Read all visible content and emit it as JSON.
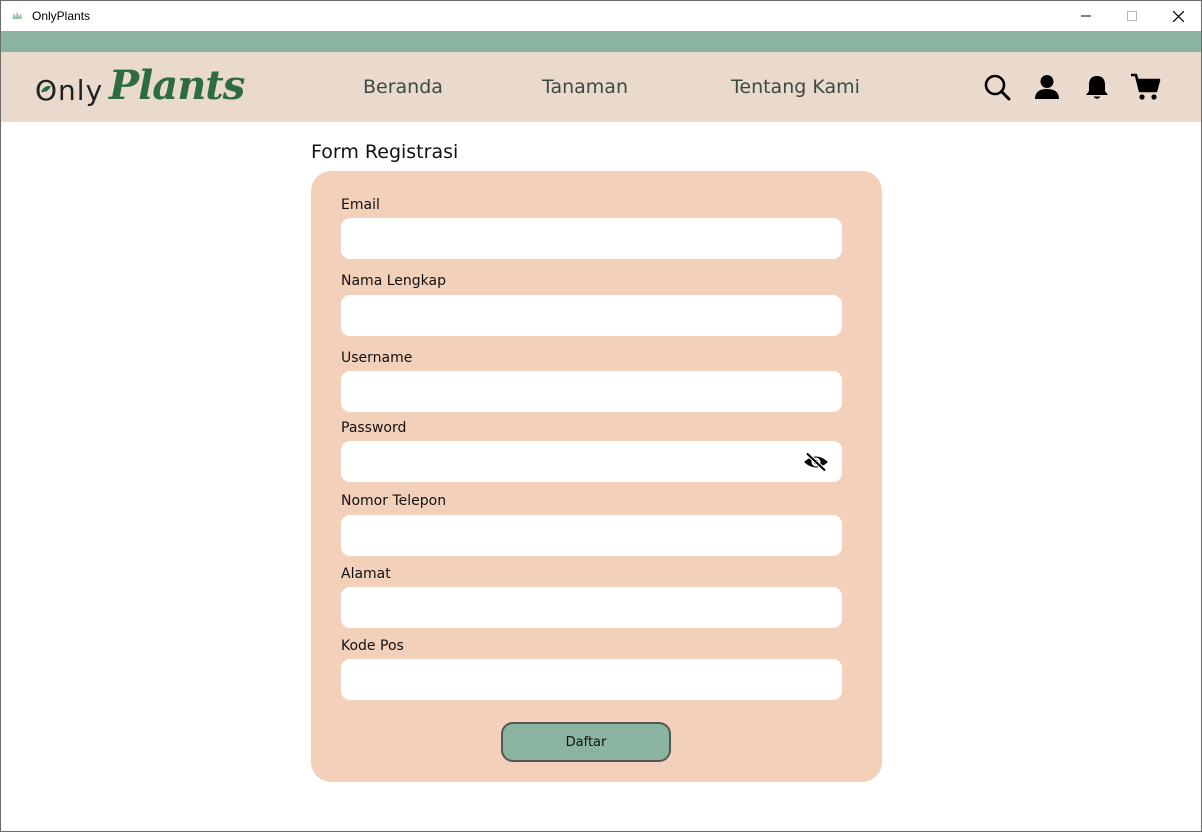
{
  "window": {
    "title": "OnlyPlants",
    "controls": [
      "minimize-icon",
      "maximize-icon",
      "close-icon"
    ]
  },
  "logo": {
    "part1": "Only",
    "part2": "Plants"
  },
  "nav": {
    "links": [
      "Beranda",
      "Tanaman",
      "Tentang Kami"
    ],
    "icons": [
      "search-icon",
      "user-icon",
      "bell-icon",
      "cart-icon"
    ]
  },
  "form": {
    "title": "Form Registrasi",
    "fields": [
      {
        "label": "Email",
        "value": ""
      },
      {
        "label": "Nama Lengkap",
        "value": ""
      },
      {
        "label": "Username",
        "value": ""
      },
      {
        "label": "Password",
        "value": ""
      },
      {
        "label": "Nomor Telepon",
        "value": ""
      },
      {
        "label": "Alamat",
        "value": ""
      },
      {
        "label": "Kode Pos",
        "value": ""
      }
    ],
    "password_toggle_icon": "eye-slash-icon",
    "submit_label": "Daftar"
  },
  "colors": {
    "accent_green": "#8ab3a0",
    "nav_bg": "#eadacd",
    "card_bg": "#f3d0b9",
    "logo_green": "#2d6b45"
  }
}
